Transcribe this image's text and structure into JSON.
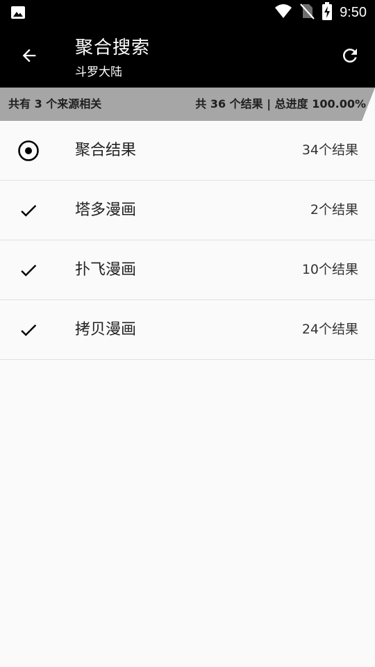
{
  "status_bar": {
    "time": "9:50",
    "icons": [
      "image-icon",
      "wifi-icon",
      "no-sim-icon",
      "battery-charging-icon"
    ]
  },
  "app_bar": {
    "title": "聚合搜索",
    "subtitle": "斗罗大陆",
    "back_icon": "arrow-back-icon",
    "refresh_icon": "refresh-icon"
  },
  "progress": {
    "left_text": "共有 3 个来源相关",
    "right_text": "共 36 个结果 | 总进度 100.00%",
    "percent": 100
  },
  "results": [
    {
      "icon": "radio-selected-icon",
      "name": "聚合结果",
      "count": "34个结果"
    },
    {
      "icon": "check-icon",
      "name": "塔多漫画",
      "count": "2个结果"
    },
    {
      "icon": "check-icon",
      "name": "扑飞漫画",
      "count": "10个结果"
    },
    {
      "icon": "check-icon",
      "name": "拷贝漫画",
      "count": "24个结果"
    }
  ]
}
